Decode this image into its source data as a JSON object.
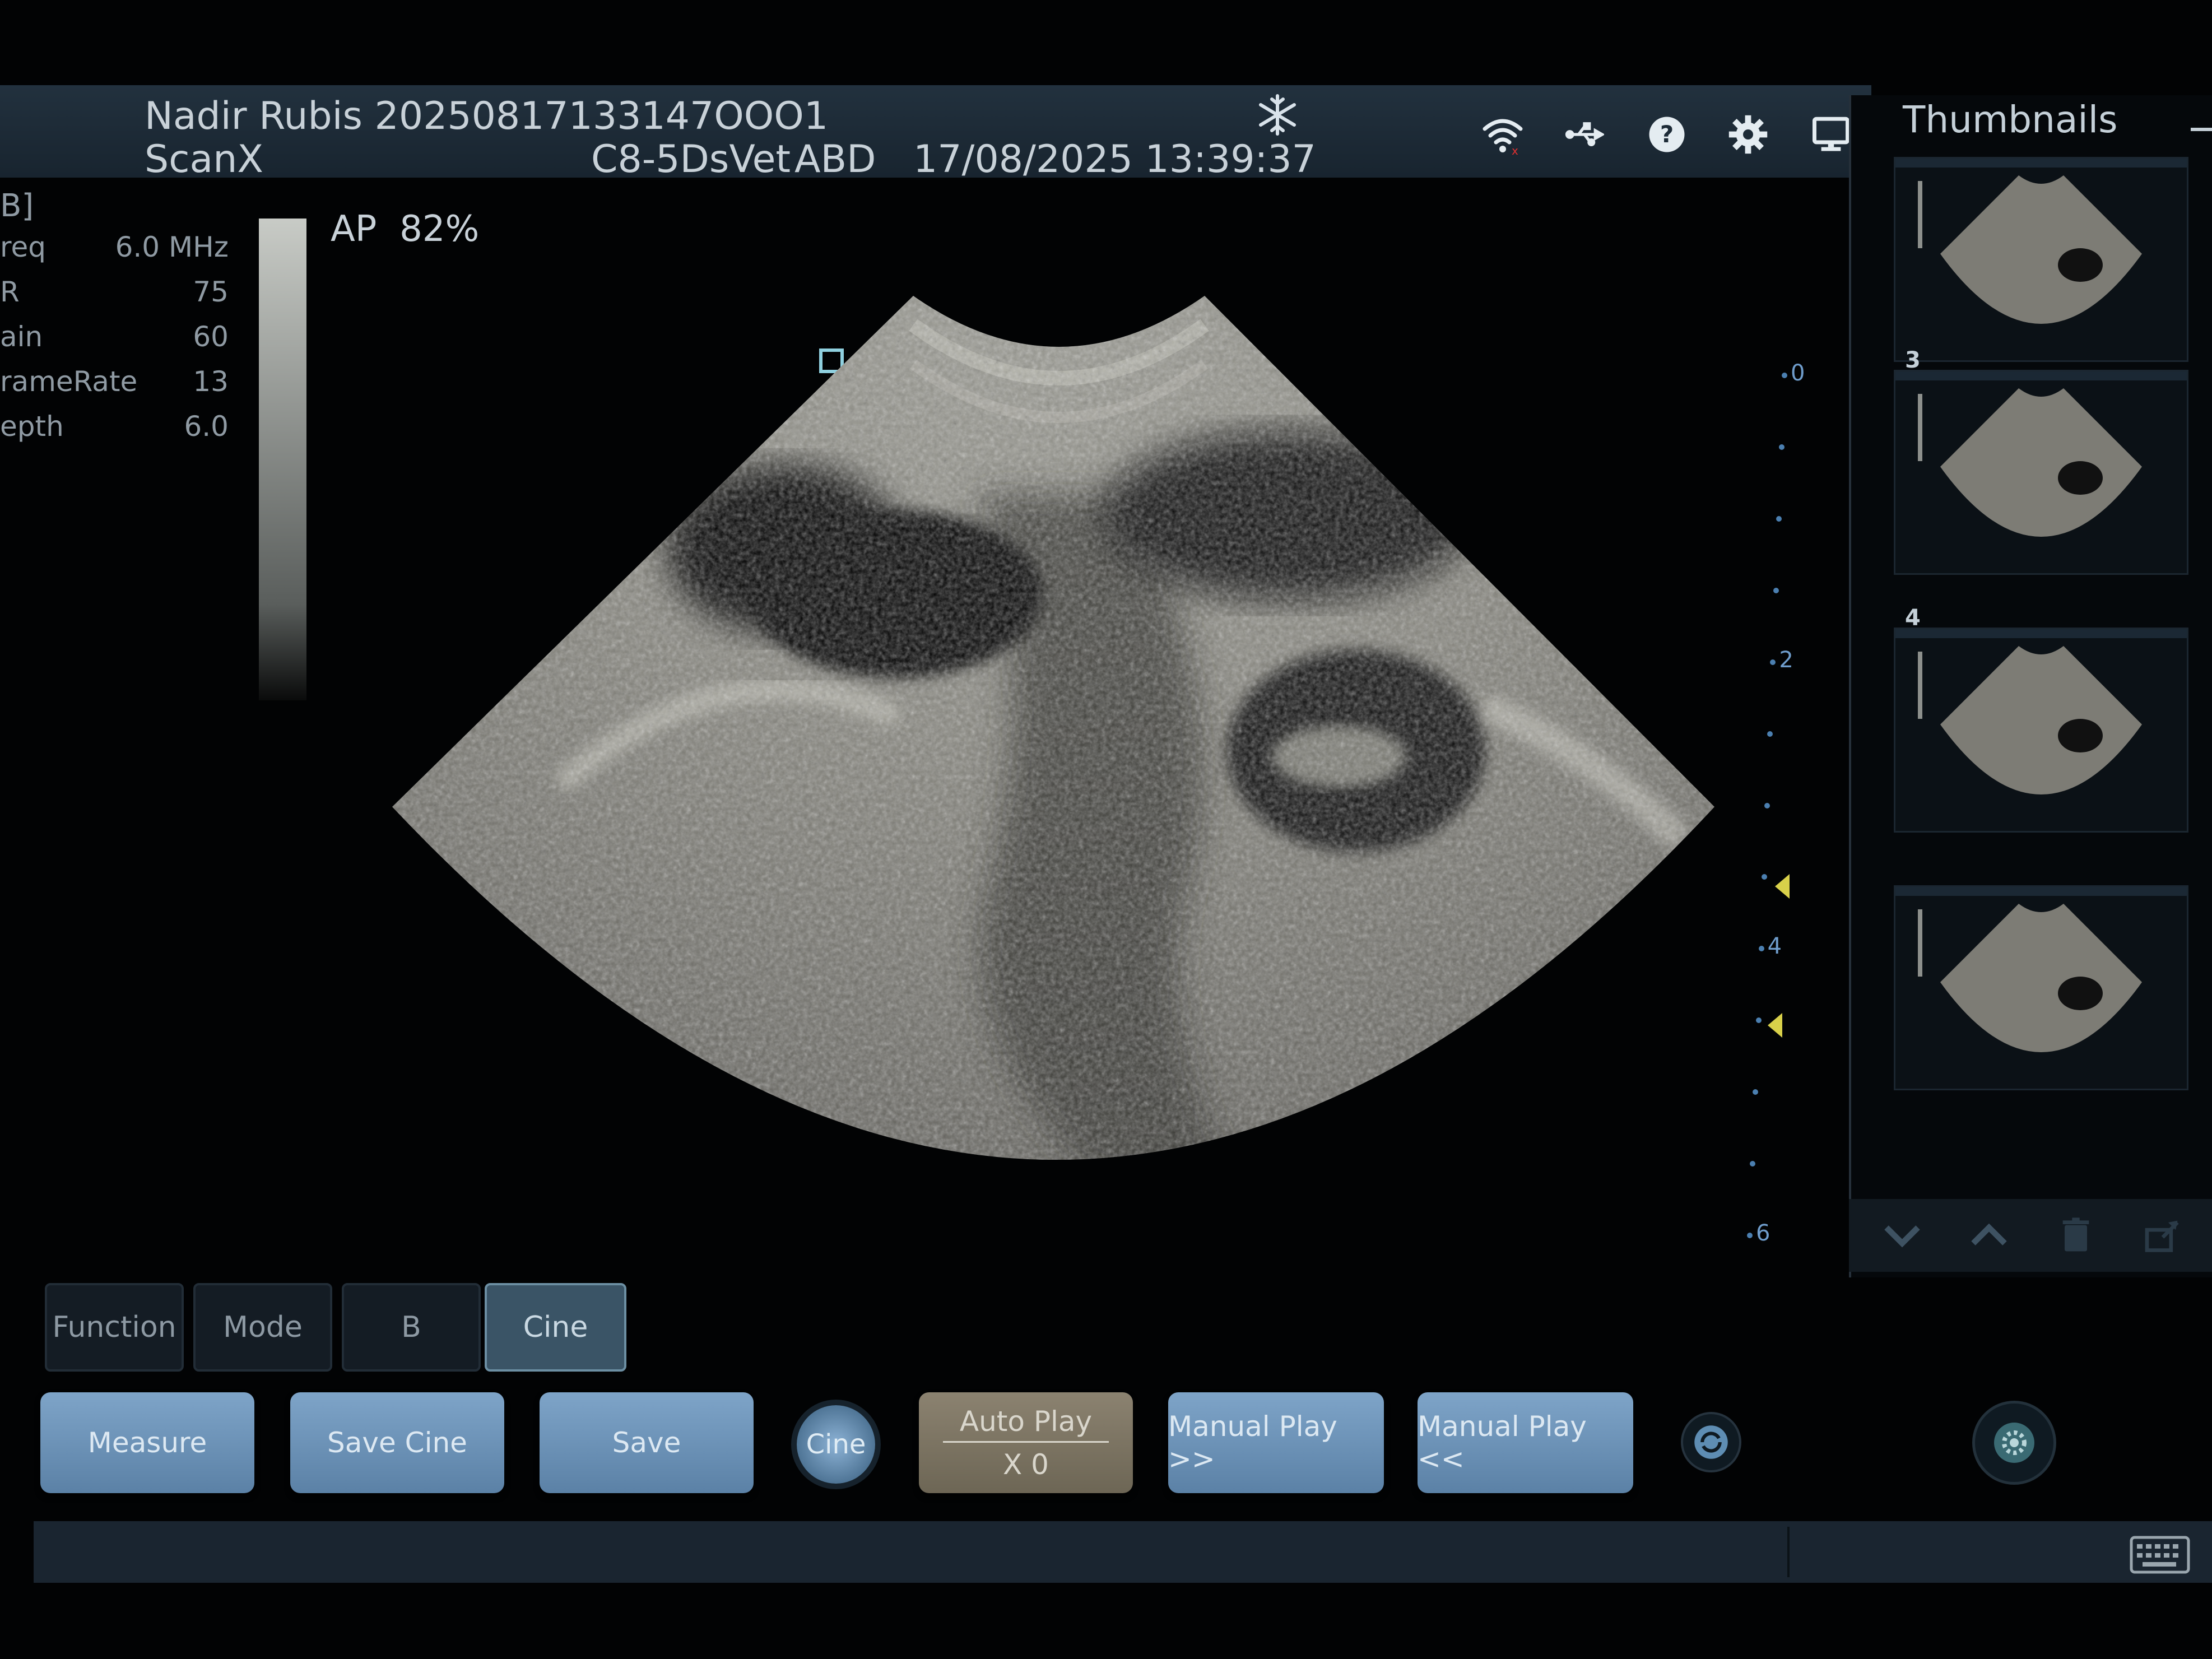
{
  "header": {
    "patient": "Nadir Rubis 20250817133147OOO1",
    "app": "ScanX",
    "probe": "C8-5DsVet",
    "preset": "ABD",
    "datetime": "17/08/2025 13:39:37"
  },
  "params": {
    "mode": "B]",
    "rows": [
      {
        "label": "req",
        "value": "6.0 MHz"
      },
      {
        "label": "R",
        "value": "75"
      },
      {
        "label": "ain",
        "value": "60"
      },
      {
        "label": "rameRate",
        "value": "13"
      },
      {
        "label": "epth",
        "value": "6.0"
      }
    ],
    "ap": "AP  82%"
  },
  "ruler": {
    "labels": [
      "0",
      "2",
      "4",
      "6"
    ]
  },
  "thumbnails": {
    "title": "Thumbnails",
    "items": [
      {
        "number": ""
      },
      {
        "number": "3"
      },
      {
        "number": "4"
      },
      {
        "number": ""
      }
    ]
  },
  "tabs": [
    {
      "label": "Function",
      "active": false
    },
    {
      "label": "Mode",
      "active": false
    },
    {
      "label": "B",
      "active": false
    },
    {
      "label": "Cine",
      "active": true
    }
  ],
  "buttons": {
    "measure": "Measure",
    "save_cine": "Save Cine",
    "save": "Save",
    "cine_knob": "Cine",
    "auto_play": "Auto Play",
    "auto_play_speed": "X 0",
    "manual_fwd": "Manual Play >>",
    "manual_back": "Manual Play <<"
  },
  "icons": {
    "freeze": "snowflake-icon",
    "wifi": "wifi-icon",
    "usb": "usb-icon",
    "help": "help-icon",
    "settings": "gear-icon",
    "display": "monitor-icon"
  },
  "colors": {
    "header_bg": "#1d2b37",
    "button_blue": "#6d93b8",
    "active_tab": "#3a5466",
    "ruler_marker": "#d8d04a"
  }
}
